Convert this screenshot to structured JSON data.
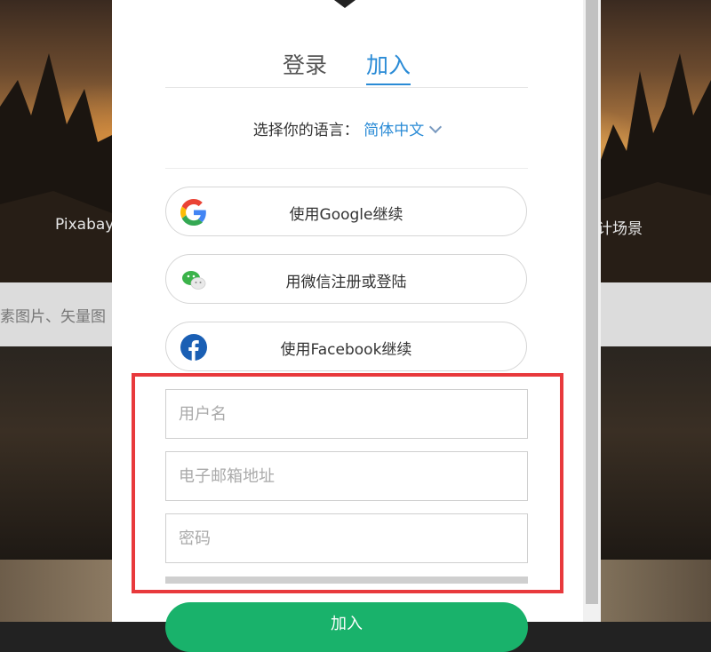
{
  "background": {
    "headline_left": "Pixabay",
    "headline_right": "设计场景",
    "search_snippet": "素图片、矢量图"
  },
  "tabs": {
    "login": "登录",
    "join": "加入",
    "active": "join"
  },
  "language": {
    "prompt": "选择你的语言：",
    "selected": "简体中文"
  },
  "social": {
    "google": "使用Google继续",
    "wechat": "用微信注册或登陆",
    "facebook": "使用Facebook继续"
  },
  "form": {
    "username_placeholder": "用户名",
    "email_placeholder": "电子邮箱地址",
    "password_placeholder": "密码"
  },
  "submit": {
    "label": "加入"
  },
  "colors": {
    "accent": "#2a8bd6",
    "highlight": "#e8393c",
    "join_button": "#19b26b"
  }
}
